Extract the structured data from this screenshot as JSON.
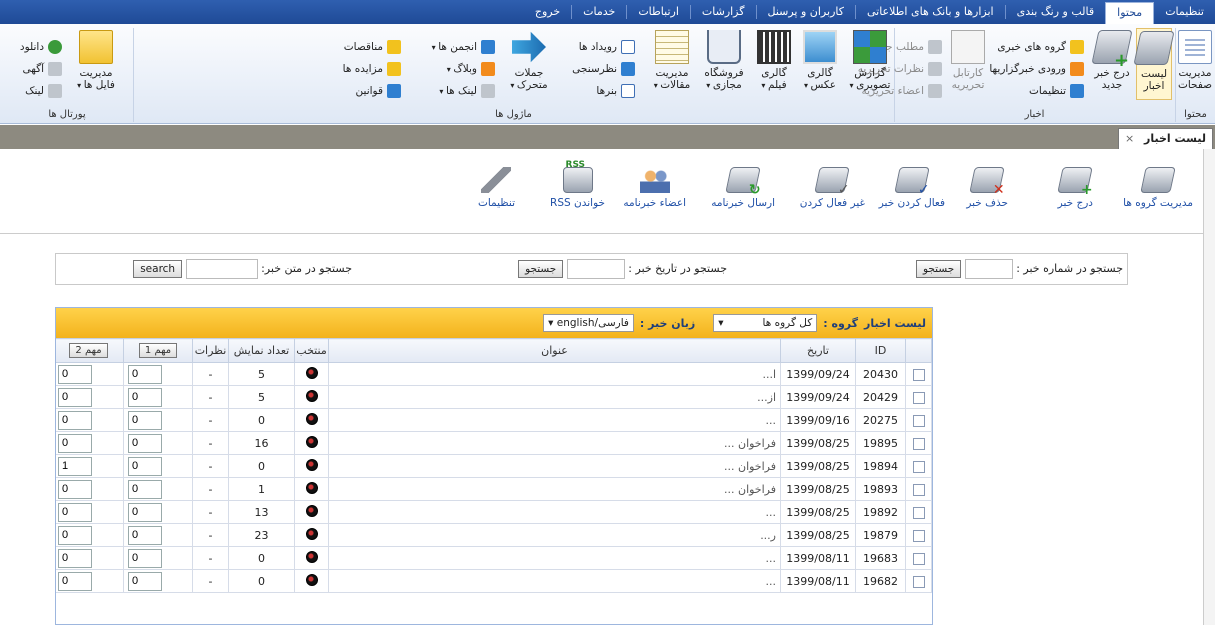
{
  "menubar": {
    "items": [
      {
        "label": "تنظیمات",
        "active": true
      },
      {
        "label": "محتوا",
        "active": true
      },
      {
        "label": "قالب و رنگ بندی"
      },
      {
        "label": "ابزارها و بانک های اطلاعاتی"
      },
      {
        "label": "کاربران و پرسنل"
      },
      {
        "label": "گزارشات"
      },
      {
        "label": "ارتباطات"
      },
      {
        "label": "خدمات"
      },
      {
        "label": "خروج"
      }
    ]
  },
  "ribbon": {
    "content": {
      "group_label": "محتوا",
      "pages_btn": "مدیریت صفحات"
    },
    "news": {
      "group_label": "اخبار",
      "list_btn": "لیست اخبار",
      "add_btn": "درج خبر جدید",
      "news_groups": "گروه های خبری",
      "news_feeds": "ورودی خبرگزاریها",
      "settings": "تنظیمات",
      "editorial_card": "کارتابل تحریریه",
      "new_article": "مطلب جدید",
      "editorial_comments": "نظرات تحریریه",
      "editorial_members": "اعضاء تحریریه"
    },
    "modules": {
      "group_label": "ماژول ها",
      "photo_report": "گزارش تصویری",
      "photo_gallery": "گالری عکس",
      "film_gallery": "گالری فیلم",
      "virtual_shop": "فروشگاه مجازی",
      "articles": "مدیریت مقالات",
      "events": "رویداد ها",
      "poll": "نظرسنجی",
      "banners": "بنرها",
      "marquee": "جملات متحرک",
      "forums": "انجمن ها",
      "blogs": "وبلاگ",
      "links": "لینک ها",
      "tenders": "مناقصات",
      "auctions": "مزایده ها",
      "laws": "قوانین"
    },
    "portals": {
      "group_label": "پورتال ها",
      "files": "مدیریت فایل ها",
      "download": "دانلود",
      "ads": "آگهی",
      "link": "لینک"
    }
  },
  "tab": {
    "title": "لیست اخبار",
    "close": "×"
  },
  "toolbar": {
    "items": [
      {
        "label": "مدیریت گروه ها",
        "icon": "news-groups-icon"
      },
      {
        "label": "درج خبر",
        "icon": "add-news-icon"
      },
      {
        "label": "حذف خبر",
        "icon": "delete-news-icon"
      },
      {
        "label": "فعال کردن خبر",
        "icon": "activate-news-icon"
      },
      {
        "label": "غیر فعال کردن",
        "icon": "deactivate-news-icon"
      },
      {
        "label": "ارسال خبرنامه",
        "icon": "send-newsletter-icon"
      },
      {
        "label": "اعضاء خبرنامه",
        "icon": "newsletter-members-icon"
      },
      {
        "label": "خواندن RSS",
        "icon": "rss-icon"
      },
      {
        "label": "تنظیمات",
        "icon": "settings-wrench-icon"
      }
    ]
  },
  "search": {
    "by_number_label": "جستجو در شماره خبر :",
    "by_date_label": "جستجو در تاریخ  خبر :",
    "by_text_label": "جستجو در متن خبر:",
    "search_btn": "جستجو",
    "search_btn_en": "search"
  },
  "grid": {
    "header": {
      "list_label": "لیست اخبار",
      "group_label": "گروه :",
      "group_value": "کل گروه ها",
      "lang_label": "زبان خبر :",
      "lang_value": "فارسی/english"
    },
    "columns": [
      "",
      "ID",
      "تاریخ",
      "عنوان",
      "منتخب",
      "تعداد نمایش",
      "نظرات",
      "مهم 1",
      "مهم 2"
    ],
    "rows": [
      {
        "id": "20430",
        "date": "1399/09/24",
        "title": "ا...",
        "views": "5",
        "comments": "-",
        "m1": "0",
        "m2": "0"
      },
      {
        "id": "20429",
        "date": "1399/09/24",
        "title": "از...",
        "views": "5",
        "comments": "-",
        "m1": "0",
        "m2": "0"
      },
      {
        "id": "20275",
        "date": "1399/09/16",
        "title": "...",
        "views": "0",
        "comments": "-",
        "m1": "0",
        "m2": "0"
      },
      {
        "id": "19895",
        "date": "1399/08/25",
        "title": "فراخوان ...",
        "views": "16",
        "comments": "-",
        "m1": "0",
        "m2": "0"
      },
      {
        "id": "19894",
        "date": "1399/08/25",
        "title": "فراخوان ...",
        "views": "0",
        "comments": "-",
        "m1": "0",
        "m2": "1"
      },
      {
        "id": "19893",
        "date": "1399/08/25",
        "title": "فراخوان ...",
        "views": "1",
        "comments": "-",
        "m1": "0",
        "m2": "0"
      },
      {
        "id": "19892",
        "date": "1399/08/25",
        "title": "...",
        "views": "13",
        "comments": "-",
        "m1": "0",
        "m2": "0"
      },
      {
        "id": "19879",
        "date": "1399/08/25",
        "title": "ر...",
        "views": "23",
        "comments": "-",
        "m1": "0",
        "m2": "0"
      },
      {
        "id": "19683",
        "date": "1399/08/11",
        "title": "...",
        "views": "0",
        "comments": "-",
        "m1": "0",
        "m2": "0"
      },
      {
        "id": "19682",
        "date": "1399/08/11",
        "title": "...",
        "views": "0",
        "comments": "-",
        "m1": "0",
        "m2": "0"
      }
    ]
  },
  "colors": {
    "menubar": "#1f4a96",
    "grid_header": "#f3b21c",
    "link": "#1f4fa6"
  }
}
